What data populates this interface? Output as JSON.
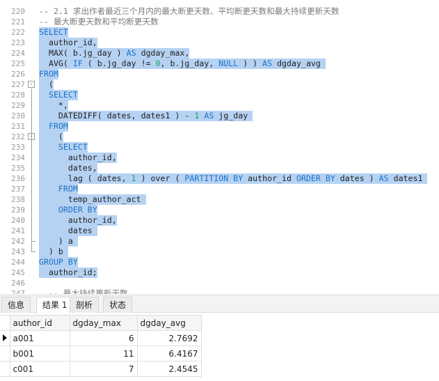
{
  "editor": {
    "lines": [
      {
        "n": "220",
        "parts": [
          {
            "t": "-- 2.1 求出作者最近三个月内的最大断更天数、平均断更天数和最大持续更新天数",
            "c": "cm"
          }
        ]
      },
      {
        "n": "221",
        "parts": [
          {
            "t": "-- 最大断更天数和平均断更天数",
            "c": "cm"
          }
        ]
      },
      {
        "n": "222",
        "parts": [
          {
            "t": "SELECT",
            "c": "kw"
          }
        ],
        "sel": true
      },
      {
        "n": "223",
        "parts": [
          {
            "t": "  author_id,",
            "c": "id"
          }
        ],
        "sel": true
      },
      {
        "n": "224",
        "parts": [
          {
            "t": "  MAX( b.jg_day ) ",
            "c": "id"
          },
          {
            "t": "AS",
            "c": "kw"
          },
          {
            "t": " dgday_max,",
            "c": "id"
          }
        ],
        "sel": true
      },
      {
        "n": "225",
        "parts": [
          {
            "t": "  AVG( ",
            "c": "id"
          },
          {
            "t": "IF",
            "c": "kw"
          },
          {
            "t": " ( b.jg_day != ",
            "c": "id"
          },
          {
            "t": "0",
            "c": "num"
          },
          {
            "t": ", b.jg_day, ",
            "c": "id"
          },
          {
            "t": "NULL",
            "c": "kw"
          },
          {
            "t": " ) ) ",
            "c": "id"
          },
          {
            "t": "AS",
            "c": "kw"
          },
          {
            "t": " dgday_avg ",
            "c": "id"
          }
        ],
        "sel": true
      },
      {
        "n": "226",
        "parts": [
          {
            "t": "FROM",
            "c": "kw"
          }
        ],
        "sel": true
      },
      {
        "n": "227",
        "parts": [
          {
            "t": "  (",
            "c": "id"
          }
        ],
        "sel": true,
        "fold": "-"
      },
      {
        "n": "228",
        "parts": [
          {
            "t": "  ",
            "c": "id"
          },
          {
            "t": "SELECT",
            "c": "kw"
          }
        ],
        "sel": true
      },
      {
        "n": "229",
        "parts": [
          {
            "t": "    *,",
            "c": "id"
          }
        ],
        "sel": true
      },
      {
        "n": "230",
        "parts": [
          {
            "t": "    DATEDIFF( dates, dates1 ) - ",
            "c": "id"
          },
          {
            "t": "1",
            "c": "num"
          },
          {
            "t": " ",
            "c": "id"
          },
          {
            "t": "AS",
            "c": "kw"
          },
          {
            "t": " jg_day ",
            "c": "id"
          }
        ],
        "sel": true
      },
      {
        "n": "231",
        "parts": [
          {
            "t": "  ",
            "c": "id"
          },
          {
            "t": "FROM",
            "c": "kw"
          }
        ],
        "sel": true
      },
      {
        "n": "232",
        "parts": [
          {
            "t": "    (",
            "c": "id"
          }
        ],
        "sel": true,
        "fold": "-"
      },
      {
        "n": "233",
        "parts": [
          {
            "t": "    ",
            "c": "id"
          },
          {
            "t": "SELECT",
            "c": "kw"
          }
        ],
        "sel": true
      },
      {
        "n": "234",
        "parts": [
          {
            "t": "      author_id,",
            "c": "id"
          }
        ],
        "sel": true
      },
      {
        "n": "235",
        "parts": [
          {
            "t": "      dates,",
            "c": "id"
          }
        ],
        "sel": true
      },
      {
        "n": "236",
        "parts": [
          {
            "t": "      lag ( dates, ",
            "c": "id"
          },
          {
            "t": "1",
            "c": "num"
          },
          {
            "t": " ) over ( ",
            "c": "id"
          },
          {
            "t": "PARTITION BY",
            "c": "kw"
          },
          {
            "t": " author_id ",
            "c": "id"
          },
          {
            "t": "ORDER BY",
            "c": "kw"
          },
          {
            "t": " dates ) ",
            "c": "id"
          },
          {
            "t": "AS",
            "c": "kw"
          },
          {
            "t": " dates1 ",
            "c": "id"
          }
        ],
        "sel": true
      },
      {
        "n": "237",
        "parts": [
          {
            "t": "    ",
            "c": "id"
          },
          {
            "t": "FROM",
            "c": "kw"
          }
        ],
        "sel": true
      },
      {
        "n": "238",
        "parts": [
          {
            "t": "      temp_author_act ",
            "c": "id"
          }
        ],
        "sel": true
      },
      {
        "n": "239",
        "parts": [
          {
            "t": "    ",
            "c": "id"
          },
          {
            "t": "ORDER BY",
            "c": "kw"
          }
        ],
        "sel": true
      },
      {
        "n": "240",
        "parts": [
          {
            "t": "      author_id,",
            "c": "id"
          }
        ],
        "sel": true
      },
      {
        "n": "241",
        "parts": [
          {
            "t": "      dates ",
            "c": "id"
          }
        ],
        "sel": true
      },
      {
        "n": "242",
        "parts": [
          {
            "t": "    ) a ",
            "c": "id"
          }
        ],
        "sel": true
      },
      {
        "n": "243",
        "parts": [
          {
            "t": "  ) b ",
            "c": "id"
          }
        ],
        "sel": true
      },
      {
        "n": "244",
        "parts": [
          {
            "t": "GROUP BY",
            "c": "kw"
          }
        ],
        "sel": true
      },
      {
        "n": "245",
        "parts": [
          {
            "t": "  author_id;",
            "c": "id"
          }
        ],
        "sel": true
      },
      {
        "n": "246",
        "parts": [
          {
            "t": "",
            "c": "id"
          }
        ]
      },
      {
        "n": "247",
        "parts": [
          {
            "t": "  -- 最大持续更新天数",
            "c": "cm"
          }
        ]
      }
    ]
  },
  "tabs": [
    {
      "label": "信息"
    },
    {
      "label": "结果 1"
    },
    {
      "label": "剖析"
    },
    {
      "label": "状态"
    }
  ],
  "active_tab": "结果 1",
  "grid": {
    "columns": [
      "author_id",
      "dgday_max",
      "dgday_avg"
    ],
    "rows": [
      [
        "a001",
        "6",
        "2.7692"
      ],
      [
        "b001",
        "11",
        "6.4167"
      ],
      [
        "c001",
        "7",
        "2.4545"
      ]
    ],
    "current_row": "a001"
  }
}
